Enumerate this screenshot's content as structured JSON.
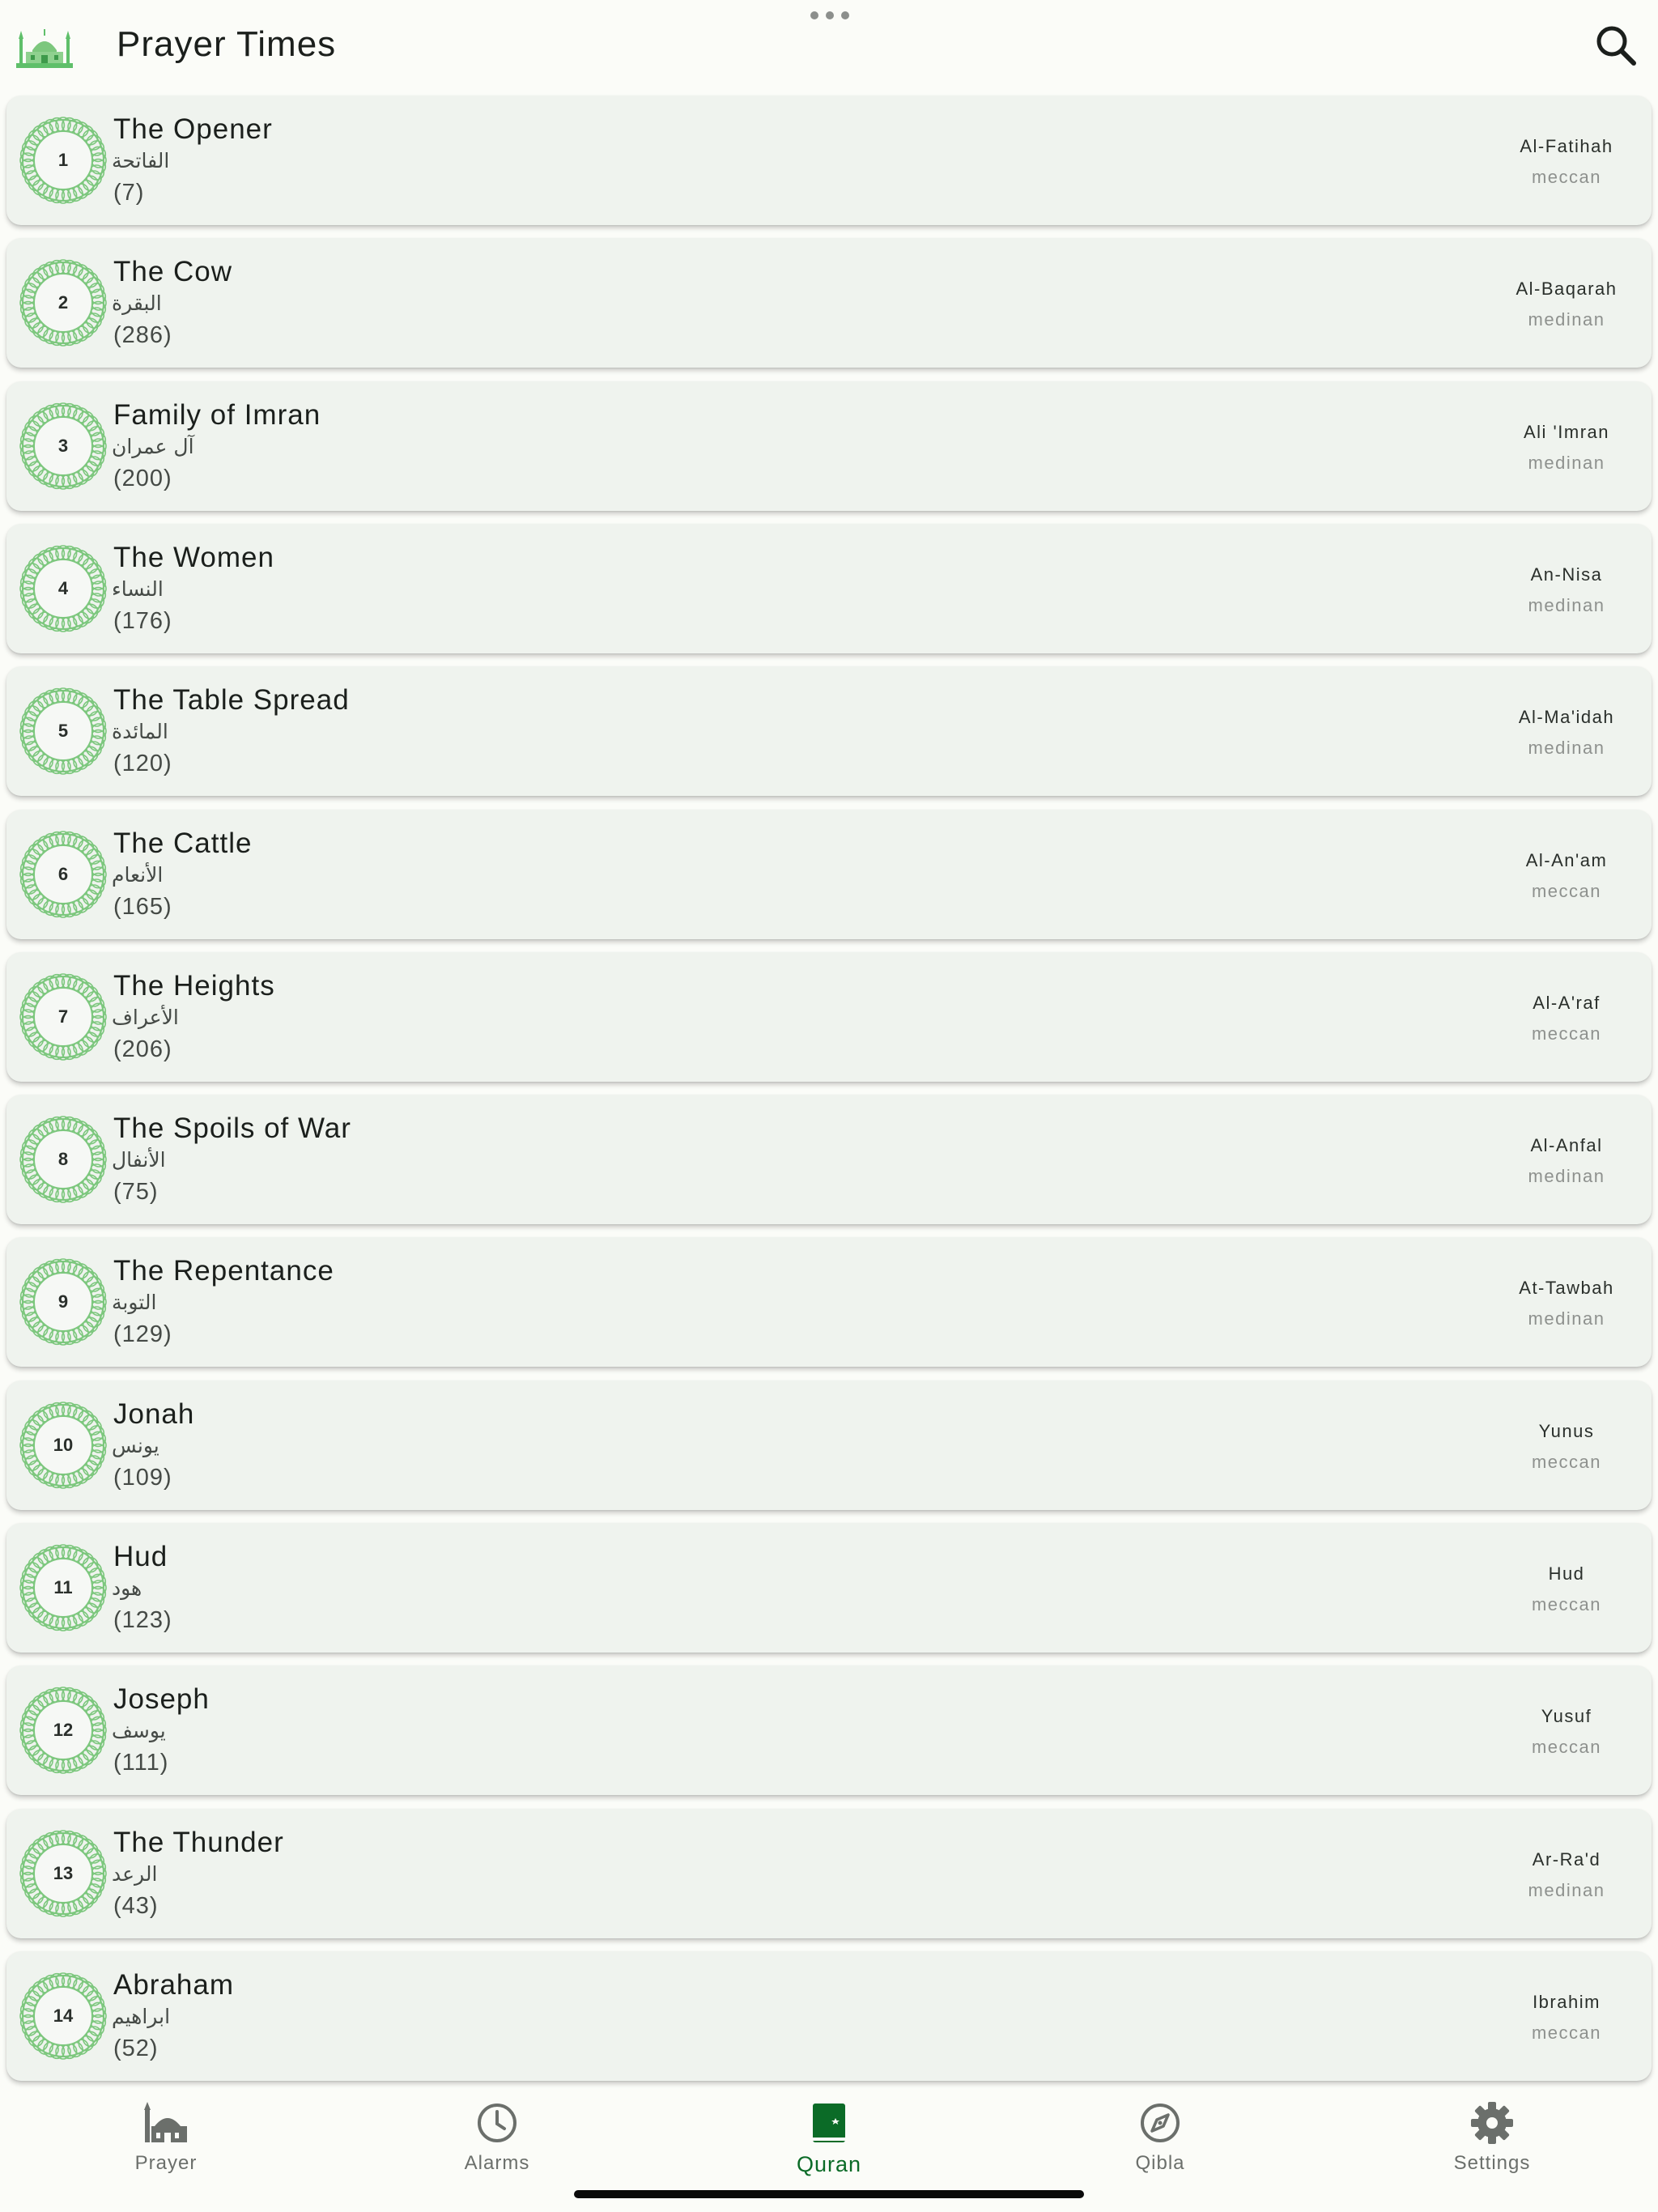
{
  "header": {
    "title": "Prayer Times",
    "logo_icon": "mosque-icon",
    "search_icon": "search-icon"
  },
  "colors": {
    "accent": "#0b6b27",
    "badge_green": "#7cc77d",
    "card_bg": "#eff3ee",
    "page_bg": "#fbfcf8"
  },
  "surahs": [
    {
      "number": "1",
      "english": "The Opener",
      "arabic": "الفاتحة",
      "verses": "(7)",
      "transliteration": "Al-Fatihah",
      "place": "meccan"
    },
    {
      "number": "2",
      "english": "The Cow",
      "arabic": "البقرة",
      "verses": "(286)",
      "transliteration": "Al-Baqarah",
      "place": "medinan"
    },
    {
      "number": "3",
      "english": "Family of Imran",
      "arabic": "آل عمران",
      "verses": "(200)",
      "transliteration": "Ali 'Imran",
      "place": "medinan"
    },
    {
      "number": "4",
      "english": "The Women",
      "arabic": "النساء",
      "verses": "(176)",
      "transliteration": "An-Nisa",
      "place": "medinan"
    },
    {
      "number": "5",
      "english": "The Table Spread",
      "arabic": "المائدة",
      "verses": "(120)",
      "transliteration": "Al-Ma'idah",
      "place": "medinan"
    },
    {
      "number": "6",
      "english": "The Cattle",
      "arabic": "الأنعام",
      "verses": "(165)",
      "transliteration": "Al-An'am",
      "place": "meccan"
    },
    {
      "number": "7",
      "english": "The Heights",
      "arabic": "الأعراف",
      "verses": "(206)",
      "transliteration": "Al-A'raf",
      "place": "meccan"
    },
    {
      "number": "8",
      "english": "The Spoils of War",
      "arabic": "الأنفال",
      "verses": "(75)",
      "transliteration": "Al-Anfal",
      "place": "medinan"
    },
    {
      "number": "9",
      "english": "The Repentance",
      "arabic": "التوبة",
      "verses": "(129)",
      "transliteration": "At-Tawbah",
      "place": "medinan"
    },
    {
      "number": "10",
      "english": "Jonah",
      "arabic": "يونس",
      "verses": "(109)",
      "transliteration": "Yunus",
      "place": "meccan"
    },
    {
      "number": "11",
      "english": "Hud",
      "arabic": "هود",
      "verses": "(123)",
      "transliteration": "Hud",
      "place": "meccan"
    },
    {
      "number": "12",
      "english": "Joseph",
      "arabic": "يوسف",
      "verses": "(111)",
      "transliteration": "Yusuf",
      "place": "meccan"
    },
    {
      "number": "13",
      "english": "The Thunder",
      "arabic": "الرعد",
      "verses": "(43)",
      "transliteration": "Ar-Ra'd",
      "place": "medinan"
    },
    {
      "number": "14",
      "english": "Abraham",
      "arabic": "ابراهيم",
      "verses": "(52)",
      "transliteration": "Ibrahim",
      "place": "meccan"
    }
  ],
  "nav": [
    {
      "label": "Prayer",
      "icon": "mosque-icon",
      "active": false
    },
    {
      "label": "Alarms",
      "icon": "clock-icon",
      "active": false
    },
    {
      "label": "Quran",
      "icon": "quran-book-icon",
      "active": true
    },
    {
      "label": "Qibla",
      "icon": "compass-icon",
      "active": false
    },
    {
      "label": "Settings",
      "icon": "gear-icon",
      "active": false
    }
  ]
}
